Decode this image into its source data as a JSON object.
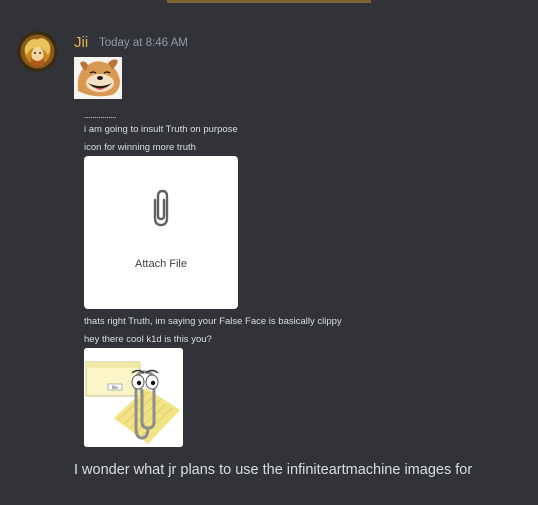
{
  "message": {
    "username": "Jii",
    "timestamp": "Today at 8:46 AM",
    "username_color": "#e3b24a",
    "lines": {
      "dots": "................",
      "insult": "i am going to insult Truth on purpose",
      "icon": "icon for winning more truth",
      "clippy": "thats right Truth, im saying your False Face is basically clippy",
      "cool": "hey there cool k1d is this you?",
      "wonder": "I wonder what jr plans to use the infiniteartmachine images for"
    },
    "attachment_card": {
      "label": "Attach File",
      "icon": "paperclip-icon"
    },
    "images": {
      "dog": "dog-meme-image",
      "clippy": "clippy-image",
      "clippy_tag": "file"
    }
  },
  "theme": {
    "background": "#313338",
    "text": "#dbdee1",
    "muted": "#949ba4"
  }
}
